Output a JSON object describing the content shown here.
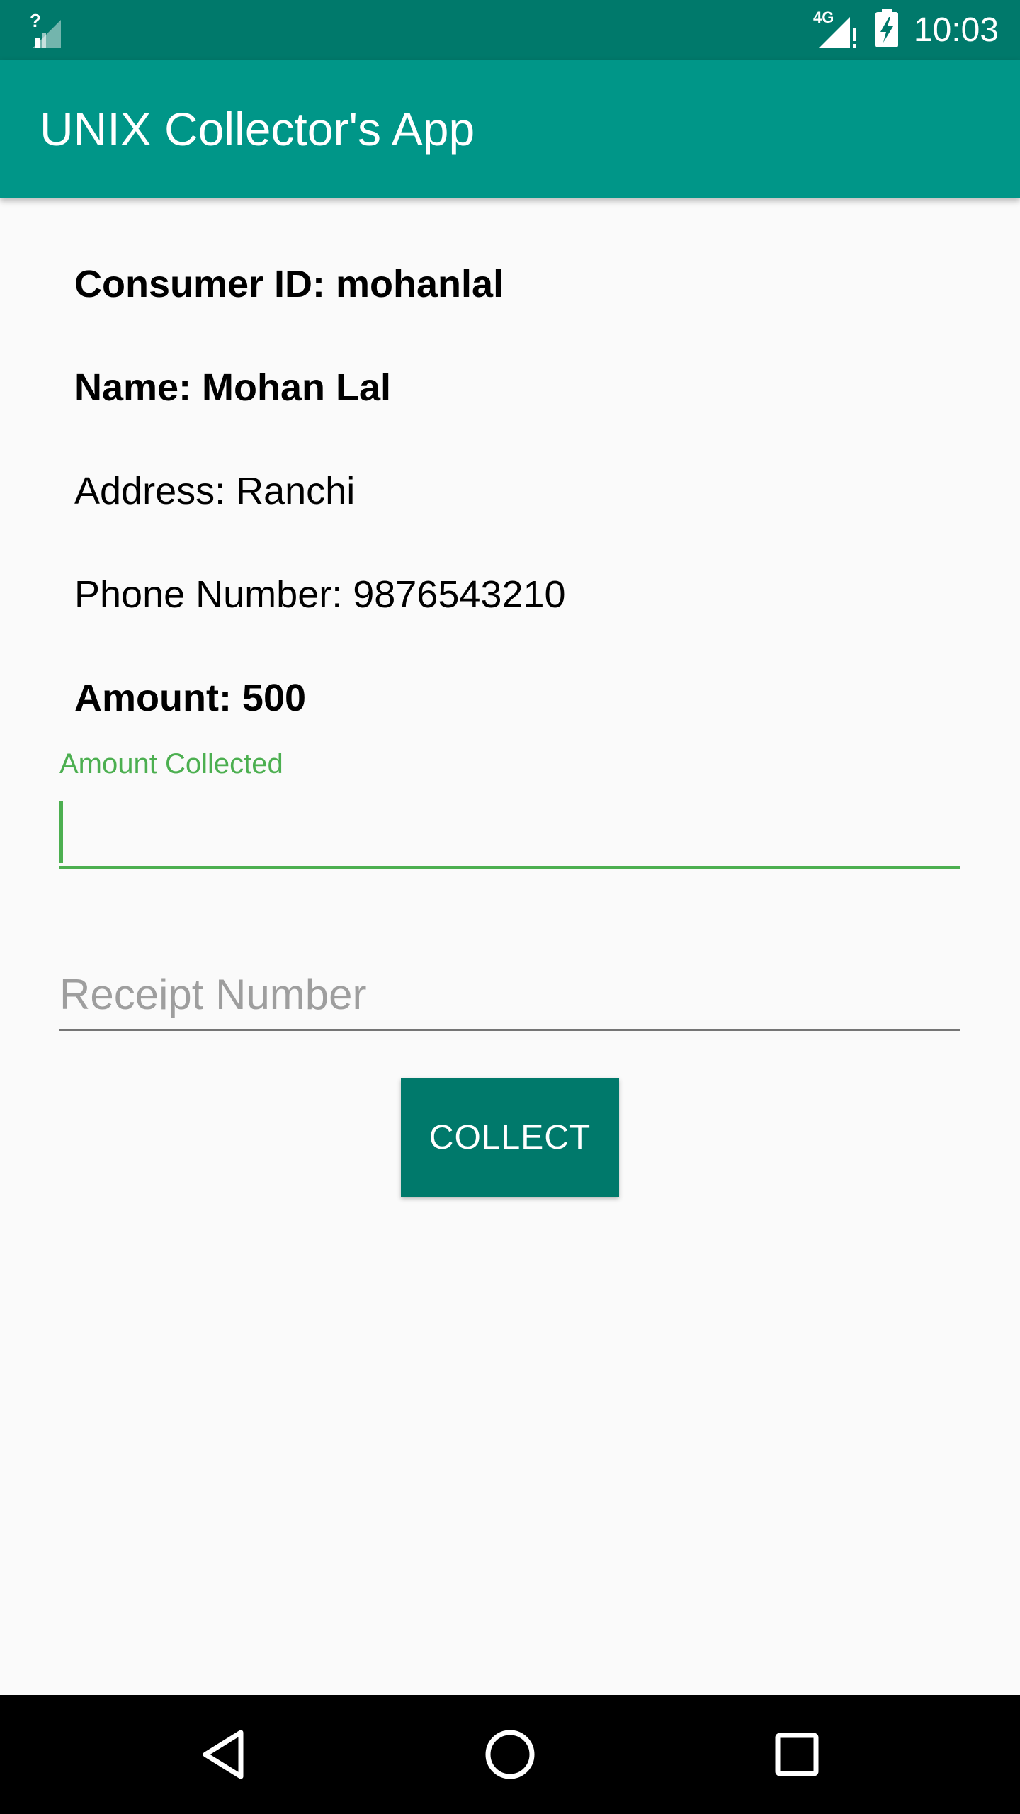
{
  "status_bar": {
    "time": "10:03",
    "network_label": "4G",
    "icons": [
      "no-sim-signal-icon",
      "mobile-signal-icon",
      "battery-charging-icon"
    ]
  },
  "app_bar": {
    "title": "UNIX Collector's App"
  },
  "consumer": {
    "consumer_id": "Consumer ID: mohanlal",
    "name": "Name: Mohan Lal",
    "address": "Address: Ranchi",
    "phone": "Phone Number: 9876543210",
    "amount": "Amount: 500"
  },
  "form": {
    "amount_collected_label": "Amount Collected",
    "amount_collected_value": "",
    "receipt_number_placeholder": "Receipt Number",
    "receipt_number_value": "",
    "collect_button_label": "COLLECT"
  },
  "nav_bar": {
    "icons": [
      "back-icon",
      "home-icon",
      "recents-icon"
    ]
  },
  "colors": {
    "status_bar": "#00796B",
    "app_bar": "#009688",
    "accent": "#4CAF50",
    "button": "#00796B"
  }
}
